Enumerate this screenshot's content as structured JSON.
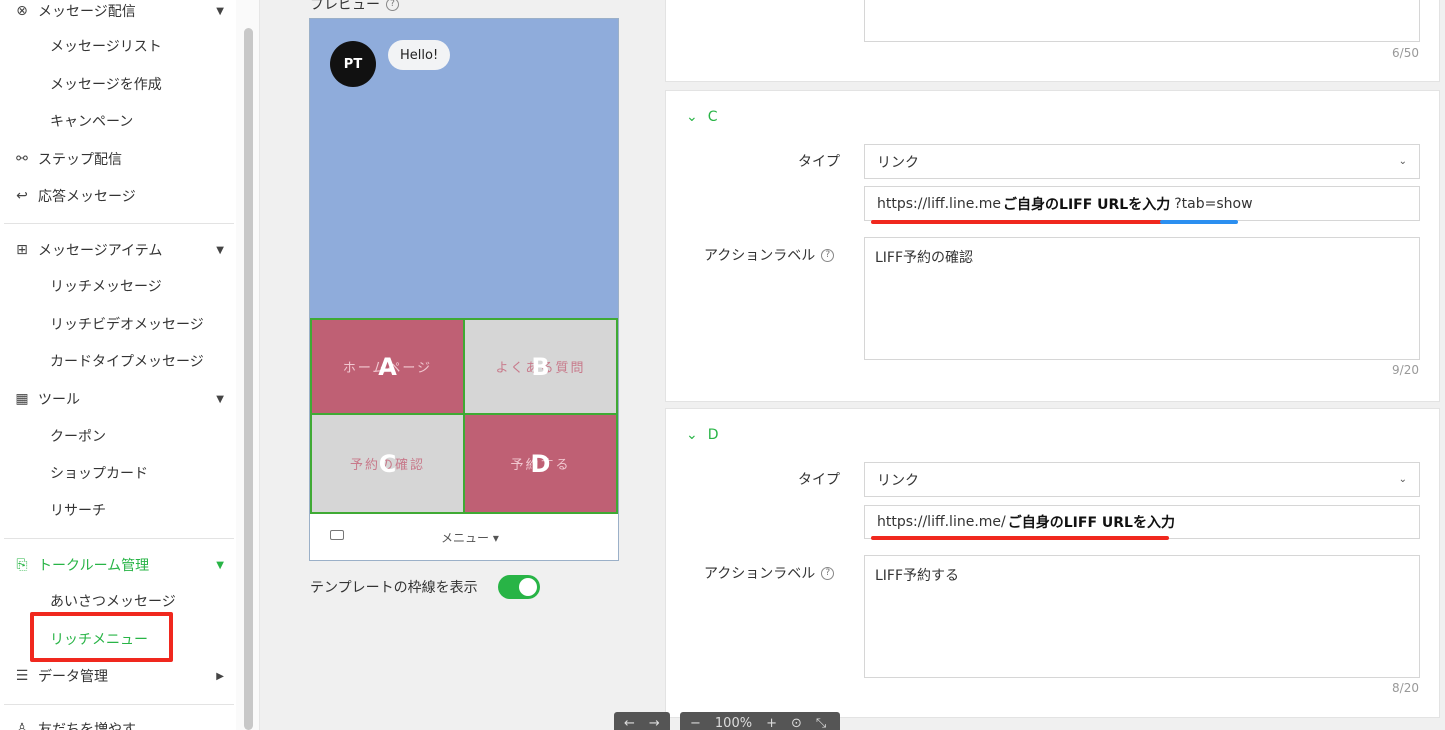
{
  "sidebar": {
    "message_group": "メッセージ配信",
    "message_items": [
      "メッセージリスト",
      "メッセージを作成",
      "キャンペーン"
    ],
    "step": "ステップ配信",
    "reply": "応答メッセージ",
    "items_group": "メッセージアイテム",
    "items": [
      "リッチメッセージ",
      "リッチビデオメッセージ",
      "カードタイプメッセージ"
    ],
    "tools_group": "ツール",
    "tools": [
      "クーポン",
      "ショップカード",
      "リサーチ"
    ],
    "talk_group": "トークルーム管理",
    "talk_items": [
      "あいさつメッセージ",
      "リッチメニュー"
    ],
    "data_group": "データ管理",
    "friends_group": "友だちを増やす"
  },
  "preview": {
    "label": "プレビュー",
    "avatar_text": "PT",
    "bubble": "Hello!",
    "cells": [
      {
        "letter": "A",
        "faint": "ホームページ"
      },
      {
        "letter": "B",
        "faint": "よくある質問"
      },
      {
        "letter": "C",
        "faint": "予約の確認"
      },
      {
        "letter": "D",
        "faint": "予約する"
      }
    ],
    "menu_text": "メニュー ▾",
    "template_toggle": "テンプレートの枠線を表示"
  },
  "top_card": {
    "counter": "6/50"
  },
  "section_c": {
    "title": "C",
    "type_label": "タイプ",
    "type_value": "リンク",
    "url_prefix": "https://liff.line.me",
    "url_note": "ご自身のLIFF URLを入力",
    "url_suffix": "?tab=show",
    "action_label": "アクションラベル",
    "action_value": "LIFF予約の確認",
    "counter": "9/20"
  },
  "section_d": {
    "title": "D",
    "type_label": "タイプ",
    "type_value": "リンク",
    "url_prefix": "https://liff.line.me/",
    "url_note": "ご自身のLIFF URLを入力",
    "action_label": "アクションラベル",
    "action_value": "LIFF予約する",
    "counter": "8/20"
  },
  "toolbar": {
    "zoom": "100%"
  }
}
